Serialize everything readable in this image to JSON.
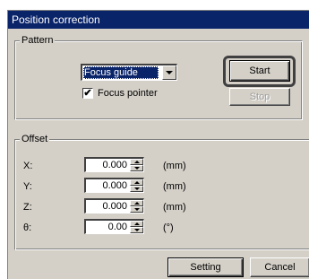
{
  "window": {
    "title": "Position correction"
  },
  "pattern": {
    "legend": "Pattern",
    "combo_value": "Focus guide",
    "focus_pointer_label": "Focus pointer",
    "focus_pointer_checked": true,
    "start_label": "Start",
    "stop_label": "Stop"
  },
  "offset": {
    "legend": "Offset",
    "rows": [
      {
        "label": "X:",
        "value": "0.000",
        "unit": "(mm)"
      },
      {
        "label": "Y:",
        "value": "0.000",
        "unit": "(mm)"
      },
      {
        "label": "Z:",
        "value": "0.000",
        "unit": "(mm)"
      },
      {
        "label": "θ:",
        "value": "0.00",
        "unit": "(°)"
      }
    ]
  },
  "buttons": {
    "setting_label": "Setting",
    "cancel_label": "Cancel"
  },
  "colors": {
    "titlebar": "#0a246a",
    "face": "#d4d0c8"
  }
}
